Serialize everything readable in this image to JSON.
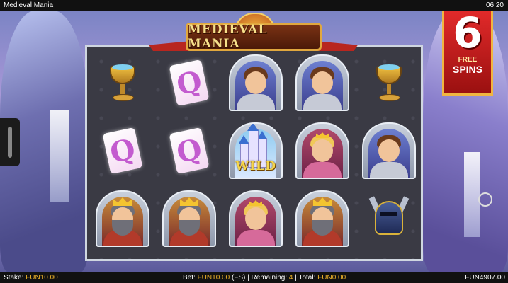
{
  "window": {
    "title": "Medieval Mania",
    "clock": "06:20"
  },
  "logo": {
    "text": "MEDIEVAL MANIA"
  },
  "free_spins": {
    "count": "6",
    "line1": "FREE",
    "line2": "SPINS"
  },
  "reels": [
    [
      "goblet",
      "card-q",
      "king"
    ],
    [
      "card-q",
      "card-q",
      "king"
    ],
    [
      "knight-prince",
      "castle-wild",
      "princess"
    ],
    [
      "knight-prince",
      "princess",
      "king"
    ],
    [
      "goblet",
      "knight-prince",
      "helmet"
    ]
  ],
  "symbols": {
    "wild_text": "WILD",
    "card_letter": "Q"
  },
  "footer": {
    "stake_label": "Stake:",
    "stake_value": "FUN10.00",
    "bet_label": "Bet:",
    "bet_value": "FUN10.00",
    "bet_mode": "(FS)",
    "remaining_label": "| Remaining:",
    "remaining_value": "4",
    "total_label": "| Total:",
    "total_value": "FUN0.00",
    "balance": "FUN4907.00"
  },
  "colors": {
    "accent": "#f0b429",
    "bar_bg": "#111111",
    "free_spins_red": "#e22a2a"
  }
}
